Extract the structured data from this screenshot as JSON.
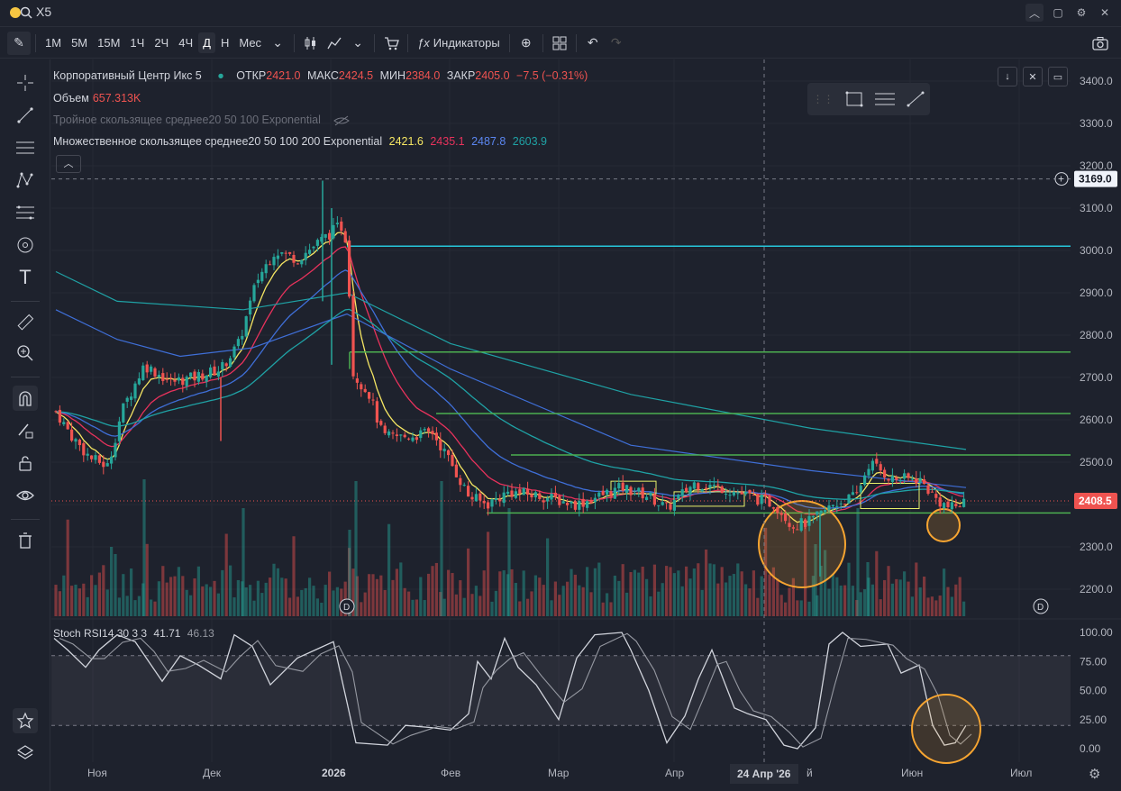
{
  "topbar": {
    "symbol": "X5"
  },
  "toolbar": {
    "intervals": [
      "1М",
      "5М",
      "15М",
      "1Ч",
      "2Ч",
      "4Ч",
      "Д",
      "Н",
      "Мес"
    ],
    "active_interval": "Д",
    "indicators_label": "Индикаторы"
  },
  "legend": {
    "name": "Корпоративный Центр Икс 5",
    "open_label": "ОТКР",
    "open": "2421.0",
    "high_label": "МАКС",
    "high": "2424.5",
    "low_label": "МИН",
    "low": "2384.0",
    "close_label": "ЗАКР",
    "close": "2405.0",
    "change": "−7.5 (−0.31%)",
    "volume_label": "Объем",
    "volume": "657.313K",
    "tema": "Тройное скользящее среднее20 50 100 Exponential",
    "multi_ma": "Множественное скользящее среднее20 50 100 200 Exponential",
    "ma_values": [
      "2421.6",
      "2435.1",
      "2487.8",
      "2603.9"
    ],
    "ma_colors": [
      "#f5e663",
      "#e8325c",
      "#3f6fd8",
      "#1fa2a5"
    ]
  },
  "stoch": {
    "label": "Stoch RSI14 30 3 3",
    "k": "41.71",
    "d": "46.13"
  },
  "price_axis": {
    "ticks": [
      "3400.0",
      "3300.0",
      "3200.0",
      "3100.0",
      "3000.0",
      "2900.0",
      "2800.0",
      "2700.0",
      "2600.0",
      "2500.0",
      "2400.0",
      "2300.0",
      "2200.0"
    ],
    "crosshair_price": "3169.0",
    "last_price": "2408.5"
  },
  "stoch_axis": {
    "ticks": [
      "100.00",
      "75.00",
      "50.00",
      "25.00",
      "0.00"
    ]
  },
  "time_axis": {
    "labels": [
      "Ноя",
      "Дек",
      "2026",
      "Фев",
      "Мар",
      "Апр",
      "Июн",
      "Июл"
    ],
    "crosshair_date": "24 Апр '26",
    "partial_label": "й"
  },
  "colors": {
    "up": "#26a69a",
    "down": "#ef5350",
    "accent": "#2962ff",
    "level": "#4caf50",
    "resistance": "#26c6da",
    "highlight": "#f7a531"
  }
}
